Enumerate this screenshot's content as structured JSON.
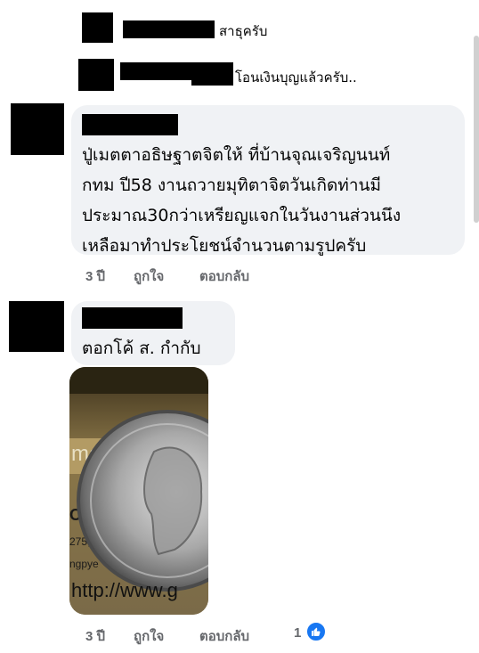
{
  "thread": {
    "reply1": {
      "text": "สาธุครับ"
    },
    "reply2": {
      "text": "โอนเงินบุญแล้วครับ.."
    }
  },
  "comment1": {
    "lines": [
      "ปู่เมตตาอธิษฐาตจิตให้ ที่บ้านจุณเจริญนนท์",
      "กทม ปี58 งานถวายมุทิตาจิตวันเกิดท่านมี",
      "ประมาณ30กว่าเหรียญแจกในวันงานส่วนนึง",
      "เหลือมาทำประโยชน์จำนวนตามรูปครับ"
    ],
    "time": "3 ปี",
    "like": "ถูกใจ",
    "reply": "ตอบกลับ"
  },
  "comment2": {
    "text": "ตอกโค้ ส. กำกับ",
    "photo": {
      "watermark": "http://www.g",
      "sign_fragments": [
        "ma",
        "OR",
        "275,",
        "ngpye"
      ]
    },
    "time": "3 ปี",
    "like": "ถูกใจ",
    "reply": "ตอบกลับ",
    "reaction_count": "1",
    "reaction_icon": "thumbs-up-icon"
  },
  "colors": {
    "bubble": "#f0f2f5",
    "meta": "#65676b",
    "like_blue": "#1877f2"
  }
}
